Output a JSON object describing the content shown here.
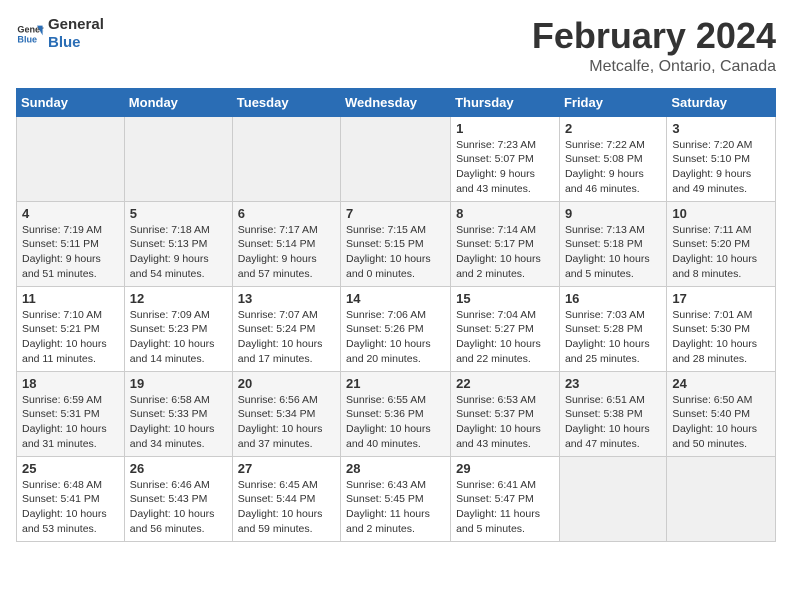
{
  "header": {
    "logo_line1": "General",
    "logo_line2": "Blue",
    "title": "February 2024",
    "subtitle": "Metcalfe, Ontario, Canada"
  },
  "weekdays": [
    "Sunday",
    "Monday",
    "Tuesday",
    "Wednesday",
    "Thursday",
    "Friday",
    "Saturday"
  ],
  "weeks": [
    [
      {
        "day": "",
        "info": ""
      },
      {
        "day": "",
        "info": ""
      },
      {
        "day": "",
        "info": ""
      },
      {
        "day": "",
        "info": ""
      },
      {
        "day": "1",
        "info": "Sunrise: 7:23 AM\nSunset: 5:07 PM\nDaylight: 9 hours\nand 43 minutes."
      },
      {
        "day": "2",
        "info": "Sunrise: 7:22 AM\nSunset: 5:08 PM\nDaylight: 9 hours\nand 46 minutes."
      },
      {
        "day": "3",
        "info": "Sunrise: 7:20 AM\nSunset: 5:10 PM\nDaylight: 9 hours\nand 49 minutes."
      }
    ],
    [
      {
        "day": "4",
        "info": "Sunrise: 7:19 AM\nSunset: 5:11 PM\nDaylight: 9 hours\nand 51 minutes."
      },
      {
        "day": "5",
        "info": "Sunrise: 7:18 AM\nSunset: 5:13 PM\nDaylight: 9 hours\nand 54 minutes."
      },
      {
        "day": "6",
        "info": "Sunrise: 7:17 AM\nSunset: 5:14 PM\nDaylight: 9 hours\nand 57 minutes."
      },
      {
        "day": "7",
        "info": "Sunrise: 7:15 AM\nSunset: 5:15 PM\nDaylight: 10 hours\nand 0 minutes."
      },
      {
        "day": "8",
        "info": "Sunrise: 7:14 AM\nSunset: 5:17 PM\nDaylight: 10 hours\nand 2 minutes."
      },
      {
        "day": "9",
        "info": "Sunrise: 7:13 AM\nSunset: 5:18 PM\nDaylight: 10 hours\nand 5 minutes."
      },
      {
        "day": "10",
        "info": "Sunrise: 7:11 AM\nSunset: 5:20 PM\nDaylight: 10 hours\nand 8 minutes."
      }
    ],
    [
      {
        "day": "11",
        "info": "Sunrise: 7:10 AM\nSunset: 5:21 PM\nDaylight: 10 hours\nand 11 minutes."
      },
      {
        "day": "12",
        "info": "Sunrise: 7:09 AM\nSunset: 5:23 PM\nDaylight: 10 hours\nand 14 minutes."
      },
      {
        "day": "13",
        "info": "Sunrise: 7:07 AM\nSunset: 5:24 PM\nDaylight: 10 hours\nand 17 minutes."
      },
      {
        "day": "14",
        "info": "Sunrise: 7:06 AM\nSunset: 5:26 PM\nDaylight: 10 hours\nand 20 minutes."
      },
      {
        "day": "15",
        "info": "Sunrise: 7:04 AM\nSunset: 5:27 PM\nDaylight: 10 hours\nand 22 minutes."
      },
      {
        "day": "16",
        "info": "Sunrise: 7:03 AM\nSunset: 5:28 PM\nDaylight: 10 hours\nand 25 minutes."
      },
      {
        "day": "17",
        "info": "Sunrise: 7:01 AM\nSunset: 5:30 PM\nDaylight: 10 hours\nand 28 minutes."
      }
    ],
    [
      {
        "day": "18",
        "info": "Sunrise: 6:59 AM\nSunset: 5:31 PM\nDaylight: 10 hours\nand 31 minutes."
      },
      {
        "day": "19",
        "info": "Sunrise: 6:58 AM\nSunset: 5:33 PM\nDaylight: 10 hours\nand 34 minutes."
      },
      {
        "day": "20",
        "info": "Sunrise: 6:56 AM\nSunset: 5:34 PM\nDaylight: 10 hours\nand 37 minutes."
      },
      {
        "day": "21",
        "info": "Sunrise: 6:55 AM\nSunset: 5:36 PM\nDaylight: 10 hours\nand 40 minutes."
      },
      {
        "day": "22",
        "info": "Sunrise: 6:53 AM\nSunset: 5:37 PM\nDaylight: 10 hours\nand 43 minutes."
      },
      {
        "day": "23",
        "info": "Sunrise: 6:51 AM\nSunset: 5:38 PM\nDaylight: 10 hours\nand 47 minutes."
      },
      {
        "day": "24",
        "info": "Sunrise: 6:50 AM\nSunset: 5:40 PM\nDaylight: 10 hours\nand 50 minutes."
      }
    ],
    [
      {
        "day": "25",
        "info": "Sunrise: 6:48 AM\nSunset: 5:41 PM\nDaylight: 10 hours\nand 53 minutes."
      },
      {
        "day": "26",
        "info": "Sunrise: 6:46 AM\nSunset: 5:43 PM\nDaylight: 10 hours\nand 56 minutes."
      },
      {
        "day": "27",
        "info": "Sunrise: 6:45 AM\nSunset: 5:44 PM\nDaylight: 10 hours\nand 59 minutes."
      },
      {
        "day": "28",
        "info": "Sunrise: 6:43 AM\nSunset: 5:45 PM\nDaylight: 11 hours\nand 2 minutes."
      },
      {
        "day": "29",
        "info": "Sunrise: 6:41 AM\nSunset: 5:47 PM\nDaylight: 11 hours\nand 5 minutes."
      },
      {
        "day": "",
        "info": ""
      },
      {
        "day": "",
        "info": ""
      }
    ]
  ]
}
